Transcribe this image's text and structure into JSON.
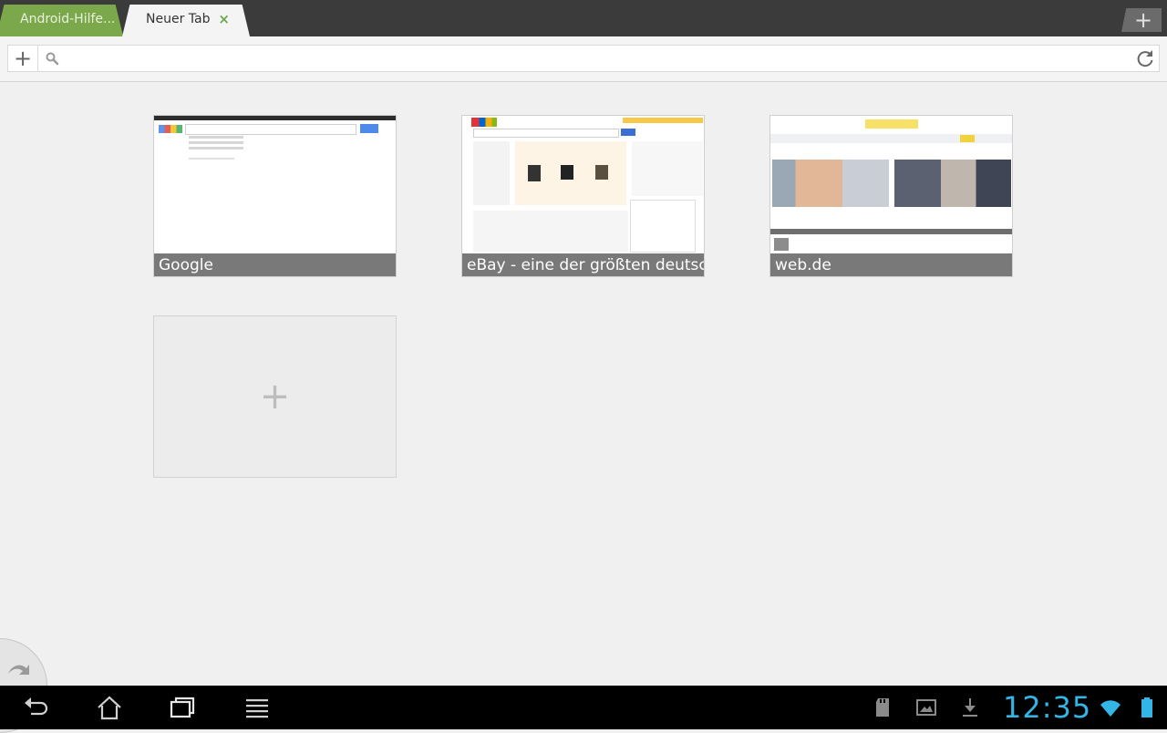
{
  "tabs": [
    {
      "label": "Android-Hilfe...",
      "active": false
    },
    {
      "label": "Neuer Tab",
      "active": true
    }
  ],
  "tab_close_symbol": "×",
  "new_tab_symbol": "+",
  "urlbar": {
    "add_symbol": "+",
    "value": "",
    "placeholder": ""
  },
  "thumbnails": [
    {
      "title": "Google"
    },
    {
      "title": "eBay - eine der größten deutsch..."
    },
    {
      "title": "web.de"
    }
  ],
  "add_tile_symbol": "+",
  "statusbar": {
    "time": "12:35"
  },
  "colors": {
    "accent": "#33b5e5",
    "active_tab_green": "#7aa84a",
    "caption_bg": "#6e6e6e"
  },
  "icons": [
    "search-icon",
    "reload-icon",
    "back-icon",
    "home-icon",
    "recent-apps-icon",
    "menu-icon",
    "sd-card-icon",
    "screenshot-icon",
    "download-icon",
    "wifi-icon",
    "battery-icon",
    "pie-control-icon"
  ]
}
